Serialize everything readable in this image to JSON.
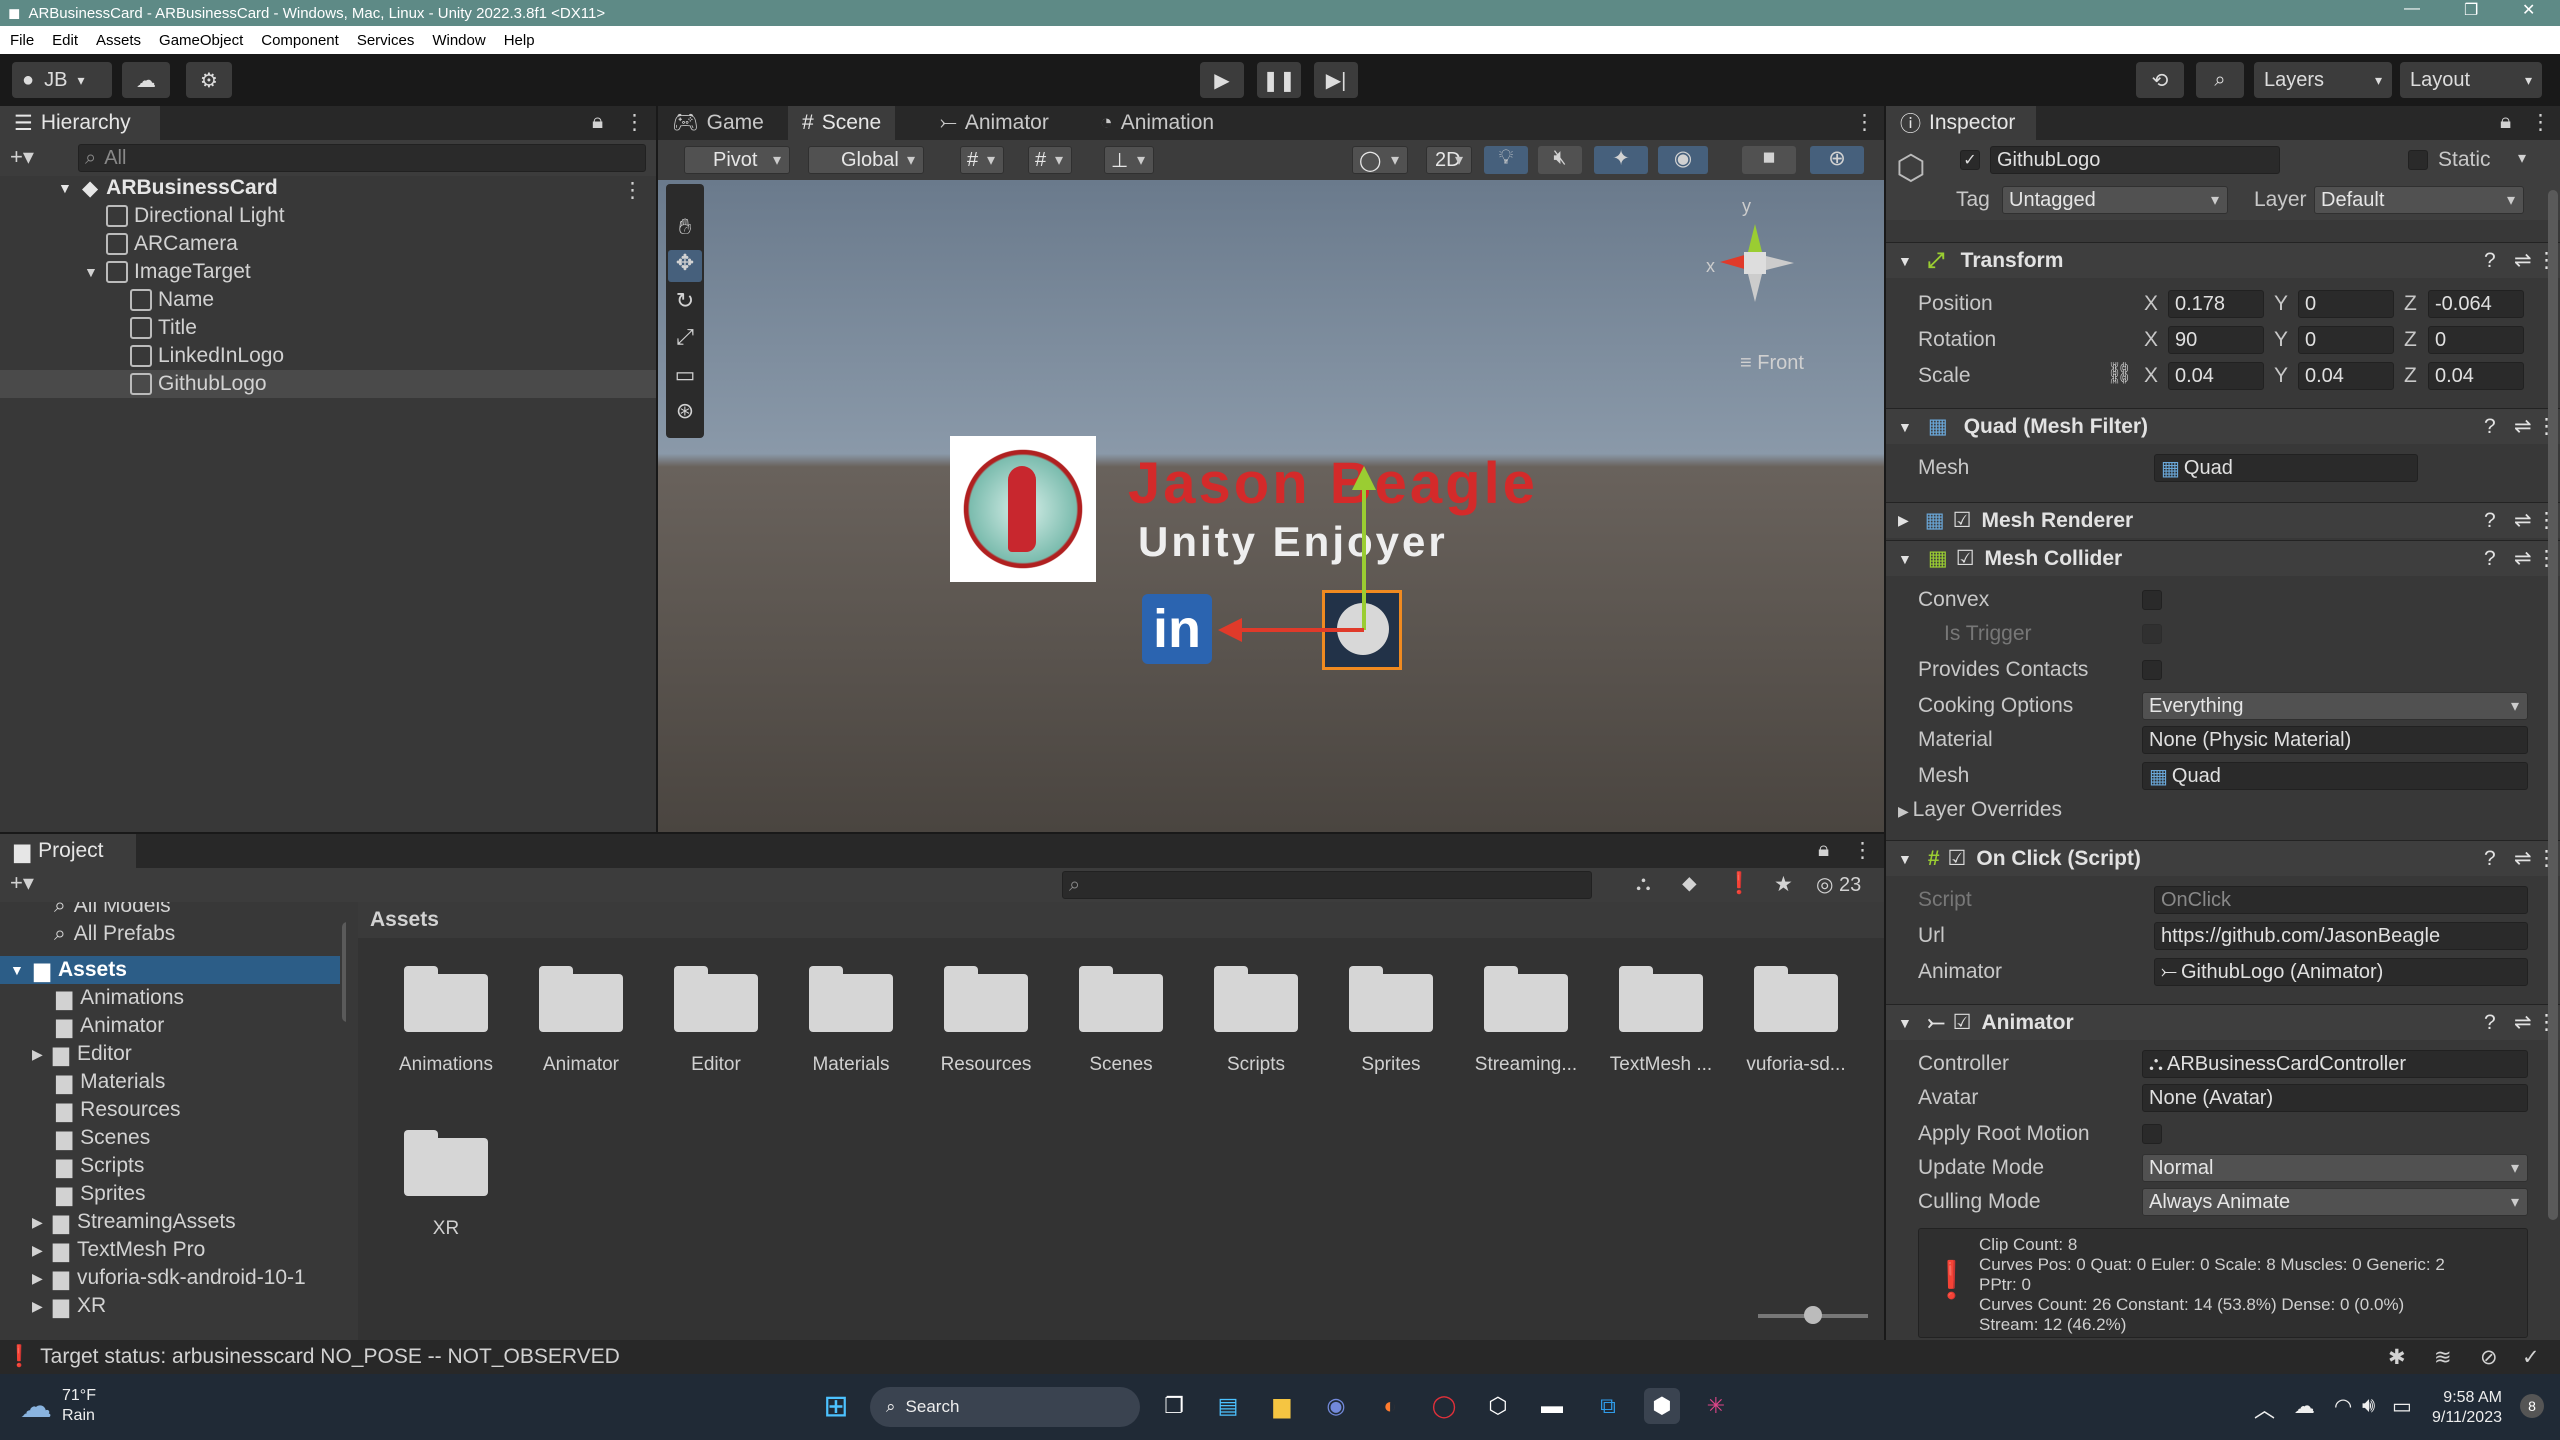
{
  "window": {
    "title": "ARBusinessCard - ARBusinessCard - Windows, Mac, Linux - Unity 2022.3.8f1 <DX11>"
  },
  "menu": [
    "File",
    "Edit",
    "Assets",
    "GameObject",
    "Component",
    "Services",
    "Window",
    "Help"
  ],
  "toolbar": {
    "account": "JB",
    "layers": "Layers",
    "layout": "Layout"
  },
  "hierarchy": {
    "title": "Hierarchy",
    "search_placeholder": "All",
    "root": "ARBusinessCard",
    "items": [
      "Directional Light",
      "ARCamera",
      "ImageTarget",
      "Name",
      "Title",
      "LinkedInLogo",
      "GithubLogo"
    ]
  },
  "scene": {
    "tabs": [
      "Game",
      "Scene",
      "Animator",
      "Animation"
    ],
    "pivot": "Pivot",
    "global": "Global",
    "mode_2d": "2D",
    "gizmo_view": "Front",
    "gizmo_y": "y",
    "gizmo_x": "x",
    "card_name": "Jason Beagle",
    "card_title": "Unity Enjoyer",
    "linkedin_text": "in"
  },
  "inspector": {
    "title": "Inspector",
    "object_name": "GithubLogo",
    "static_label": "Static",
    "tag_label": "Tag",
    "tag_value": "Untagged",
    "layer_label": "Layer",
    "layer_value": "Default",
    "transform": {
      "title": "Transform",
      "position_label": "Position",
      "pos": [
        "0.178",
        "0",
        "-0.064"
      ],
      "rotation_label": "Rotation",
      "rot": [
        "90",
        "0",
        "0"
      ],
      "scale_label": "Scale",
      "scale": [
        "0.04",
        "0.04",
        "0.04"
      ]
    },
    "mesh_filter": {
      "title": "Quad (Mesh Filter)",
      "mesh_label": "Mesh",
      "mesh_value": "Quad"
    },
    "mesh_renderer": {
      "title": "Mesh Renderer"
    },
    "mesh_collider": {
      "title": "Mesh Collider",
      "convex": "Convex",
      "is_trigger": "Is Trigger",
      "provides_contacts": "Provides Contacts",
      "cooking_label": "Cooking Options",
      "cooking_value": "Everything",
      "material_label": "Material",
      "material_value": "None (Physic Material)",
      "mesh_label": "Mesh",
      "mesh_value": "Quad",
      "layer_overrides": "Layer Overrides"
    },
    "onclick": {
      "title": "On Click (Script)",
      "script_label": "Script",
      "script_value": "OnClick",
      "url_label": "Url",
      "url_value": "https://github.com/JasonBeagle",
      "animator_label": "Animator",
      "animator_value": "GithubLogo (Animator)"
    },
    "animator": {
      "title": "Animator",
      "controller_label": "Controller",
      "controller_value": "ARBusinessCardController",
      "avatar_label": "Avatar",
      "avatar_value": "None (Avatar)",
      "apply_root_motion": "Apply Root Motion",
      "update_label": "Update Mode",
      "update_value": "Normal",
      "culling_label": "Culling Mode",
      "culling_value": "Always Animate",
      "info": [
        "Clip Count: 8",
        "Curves Pos: 0 Quat: 0 Euler: 0 Scale: 8 Muscles: 0 Generic: 2",
        "PPtr: 0",
        "Curves Count: 26 Constant: 14 (53.8%) Dense: 0 (0.0%)",
        "Stream: 12 (46.2%)"
      ]
    }
  },
  "project": {
    "title": "Project",
    "hidden_count": "23",
    "tree_top": [
      "All Models",
      "All Prefabs"
    ],
    "assets_root": "Assets",
    "tree": [
      "Animations",
      "Animator",
      "Editor",
      "Materials",
      "Resources",
      "Scenes",
      "Scripts",
      "Sprites",
      "StreamingAssets",
      "TextMesh Pro",
      "vuforia-sdk-android-10-1",
      "XR"
    ],
    "breadcrumb": "Assets",
    "folders": [
      "Animations",
      "Animator",
      "Editor",
      "Materials",
      "Resources",
      "Scenes",
      "Scripts",
      "Sprites",
      "Streaming...",
      "TextMesh ...",
      "vuforia-sd...",
      "XR"
    ]
  },
  "status": {
    "text": "Target status: arbusinesscard NO_POSE -- NOT_OBSERVED"
  },
  "taskbar": {
    "weather_temp": "71°F",
    "weather_desc": "Rain",
    "search": "Search",
    "time": "9:58 AM",
    "date": "9/11/2023",
    "notification_count": "8"
  }
}
